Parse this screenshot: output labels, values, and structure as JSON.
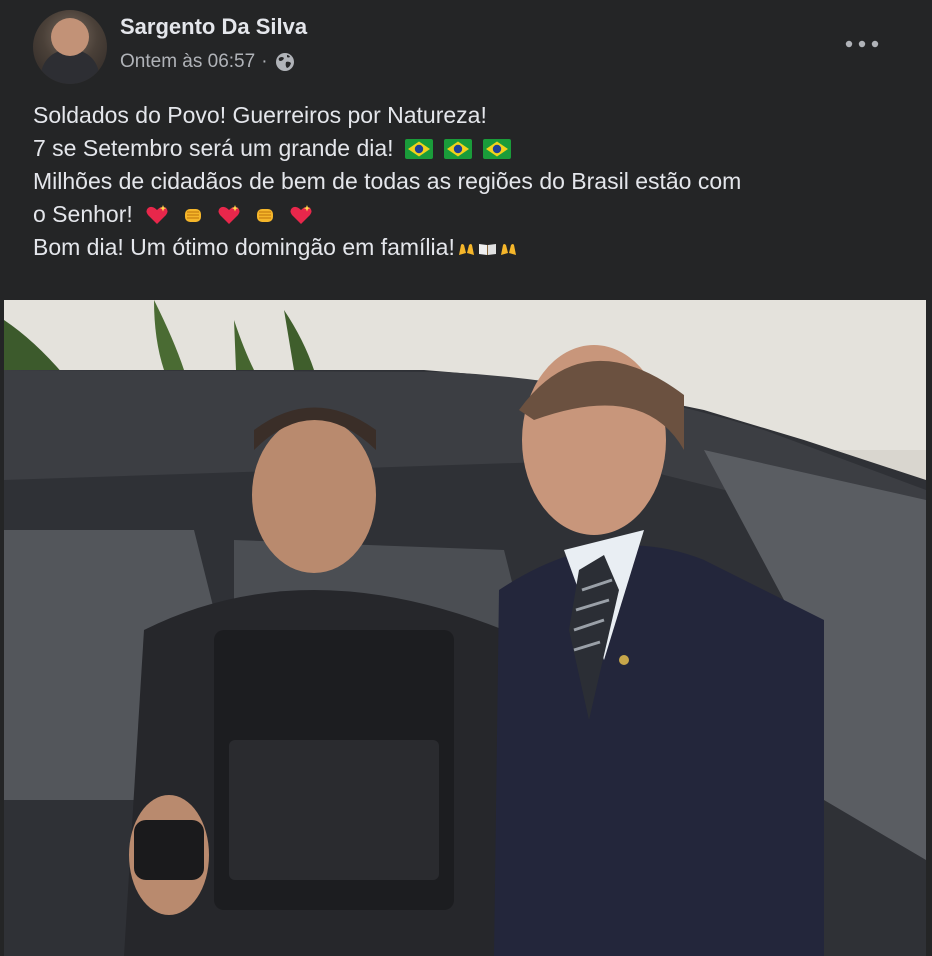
{
  "post": {
    "author": "Sargento Da Silva",
    "timestamp": "Ontem às 06:57",
    "separator": "·",
    "privacy_icon": "globe-icon",
    "more_icon": "more-options-icon",
    "text_lines": [
      "Soldados do Povo! Guerreiros por Natureza!",
      "7 se Setembro será um grande dia!",
      "Milhões de cidadãos de bem de todas as regiões do Brasil estão com",
      "o Senhor!",
      "Bom dia! Um ótimo domingão em família!"
    ],
    "emojis": {
      "line2": [
        "brazil-flag",
        "brazil-flag",
        "brazil-flag"
      ],
      "line4": [
        "sparkling-heart",
        "fist",
        "sparkling-heart",
        "fist",
        "sparkling-heart"
      ],
      "line5": [
        "raised-hands",
        "open-book",
        "raised-hands"
      ]
    },
    "photo": "photo of a uniformed police officer giving thumbs up next to a man in a dark suit, in front of a dark car"
  },
  "colors": {
    "background": "#242526",
    "text_primary": "#e4e6eb",
    "text_secondary": "#b0b3b8"
  }
}
